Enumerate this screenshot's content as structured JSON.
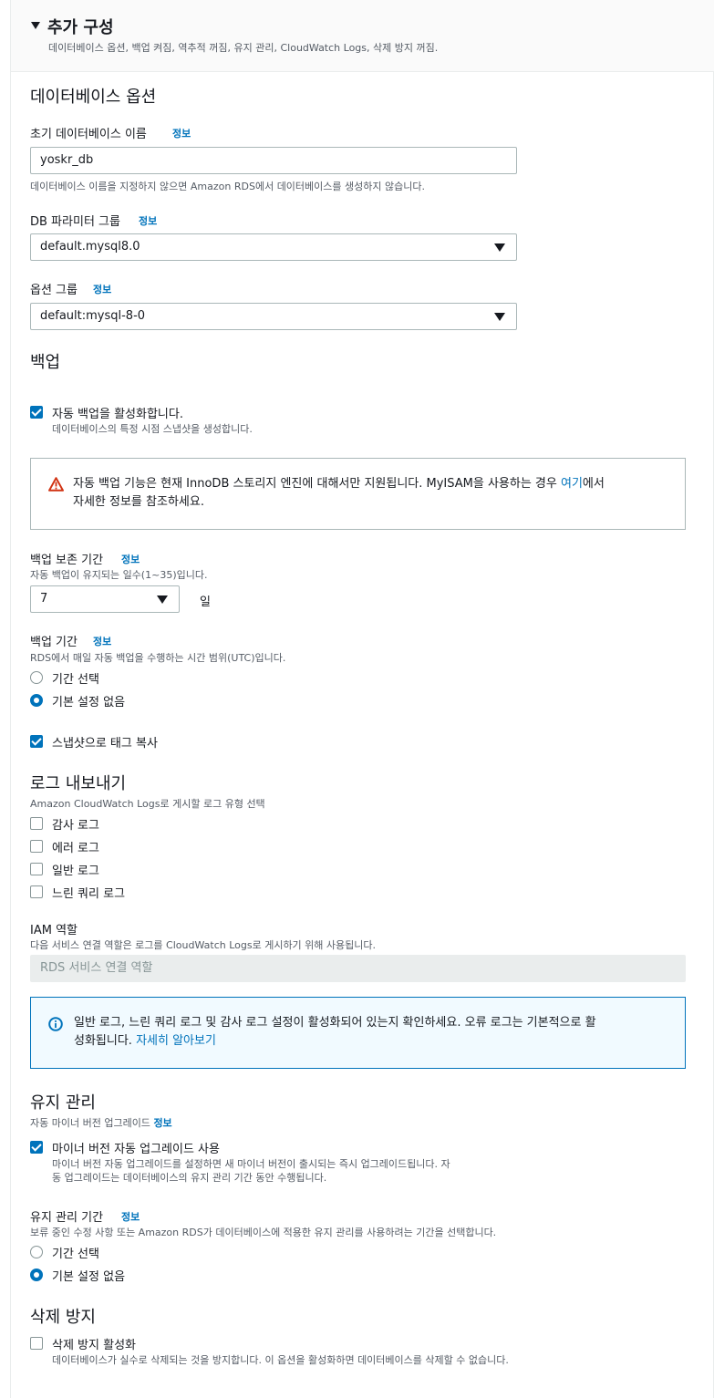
{
  "section": {
    "title": "추가 구성",
    "subtitle": "데이터베이스 옵션, 백업 켜짐, 역추적 꺼짐, 유지 관리, CloudWatch Logs, 삭제 방지 꺼짐."
  },
  "info_link": "정보",
  "db_options": {
    "heading": "데이터베이스 옵션",
    "initial_db_label": "초기 데이터베이스 이름",
    "initial_db_value": "yoskr_db",
    "initial_db_help": "데이터베이스 이름을 지정하지 않으면 Amazon RDS에서 데이터베이스를 생성하지 않습니다.",
    "param_group_label": "DB 파라미터 그룹",
    "param_group_value": "default.mysql8.0",
    "option_group_label": "옵션 그룹",
    "option_group_value": "default:mysql-8-0"
  },
  "backup": {
    "heading": "백업",
    "auto_backup_label": "자동 백업을 활성화합니다.",
    "auto_backup_desc": "데이터베이스의 특정 시점 스냅샷을 생성합니다.",
    "auto_backup_checked": true,
    "warning_text_1": "자동 백업 기능은 현재 InnoDB 스토리지 엔진에 대해서만 지원됩니다. MyISAM을 사용하는 경우 ",
    "warning_link": "여기",
    "warning_text_2": "에서",
    "warning_text_3": "자세한 정보를 참조하세요.",
    "retention_label": "백업 보존 기간",
    "retention_desc": "자동 백업이 유지되는 일수(1~35)입니다.",
    "retention_value": "7",
    "retention_unit": "일",
    "window_label": "백업 기간",
    "window_desc": "RDS에서 매일 자동 백업을 수행하는 시간 범위(UTC)입니다.",
    "window_options": [
      "기간 선택",
      "기본 설정 없음"
    ],
    "window_selected": 1,
    "copy_tags_label": "스냅샷으로 태그 복사",
    "copy_tags_checked": true
  },
  "logs": {
    "heading": "로그 내보내기",
    "desc": "Amazon CloudWatch Logs로 게시할 로그 유형 선택",
    "items": [
      "감사 로그",
      "에러 로그",
      "일반 로그",
      "느린 쿼리 로그"
    ],
    "iam_label": "IAM 역할",
    "iam_desc": "다음 서비스 연결 역할은 로그를 CloudWatch Logs로 게시하기 위해 사용됩니다.",
    "iam_value": "RDS 서비스 연결 역할",
    "info_text_1": "일반 로그, 느린 쿼리 로그 및 감사 로그 설정이 활성화되어 있는지 확인하세요. 오류 로그는 기본적으로 활",
    "info_text_2": "성화됩니다. ",
    "info_link": "자세히 알아보기"
  },
  "maintenance": {
    "heading": "유지 관리",
    "minor_label": "자동 마이너 버전 업그레이드",
    "minor_check_label": "마이너 버전 자동 업그레이드 사용",
    "minor_desc_1": "마이너 버전 자동 업그레이드를 설정하면 새 마이너 버전이 출시되는 즉시 업그레이드됩니다. 자",
    "minor_desc_2": "동 업그레이드는 데이터베이스의 유지 관리 기간 동안 수행됩니다.",
    "minor_checked": true,
    "window_label": "유지 관리 기간",
    "window_desc": "보류 중인 수정 사항 또는 Amazon RDS가 데이터베이스에 적용한 유지 관리를 사용하려는 기간을 선택합니다.",
    "window_options": [
      "기간 선택",
      "기본 설정 없음"
    ],
    "window_selected": 1
  },
  "deletion": {
    "heading": "삭제 방지",
    "check_label": "삭제 방지 활성화",
    "check_desc": "데이터베이스가 실수로 삭제되는 것을 방지합니다. 이 옵션을 활성화하면 데이터베이스를 삭제할 수 없습니다.",
    "checked": false
  }
}
